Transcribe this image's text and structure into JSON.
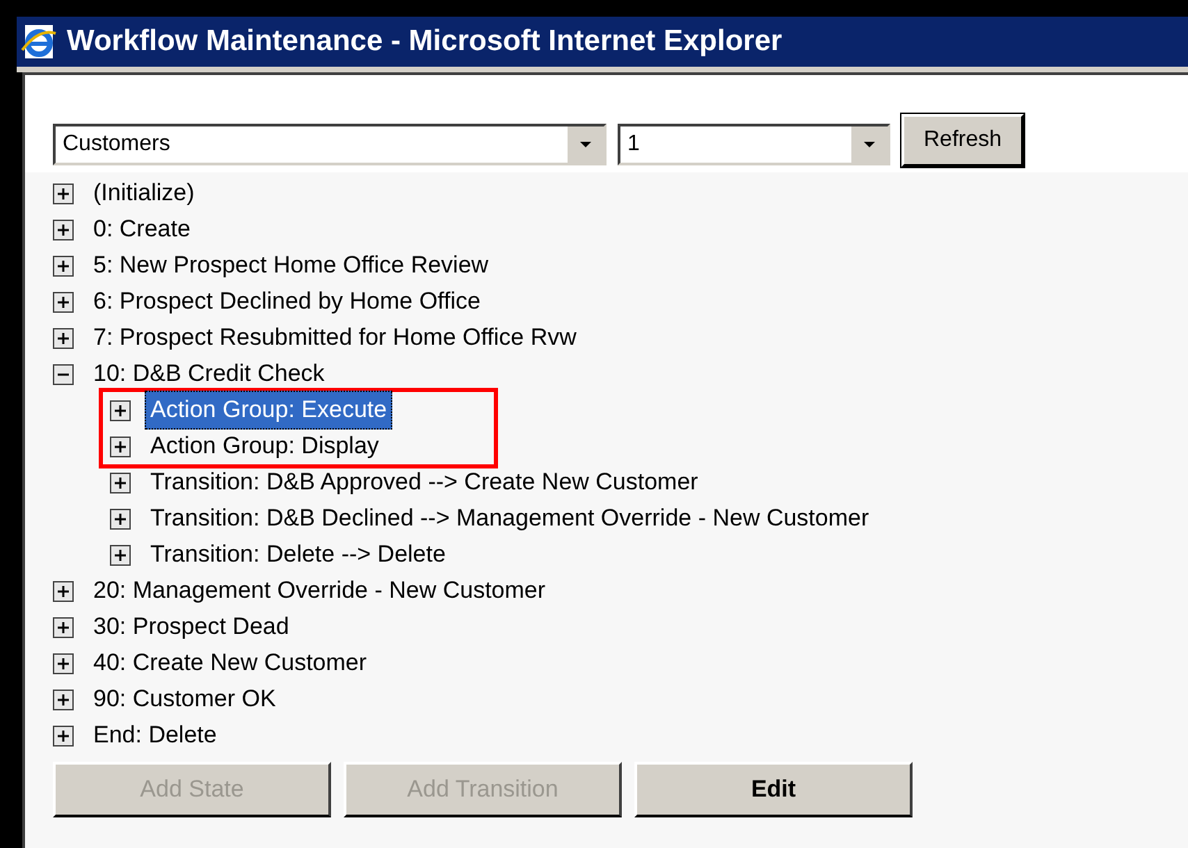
{
  "window": {
    "title": "Workflow Maintenance - Microsoft Internet Explorer"
  },
  "toolbar": {
    "workflow_select": {
      "value": "Customers"
    },
    "version_select": {
      "value": "1"
    },
    "refresh_button": "Refresh"
  },
  "tree": [
    {
      "label": "(Initialize)",
      "expanded": false,
      "selected": false
    },
    {
      "label": "0: Create",
      "expanded": false,
      "selected": false
    },
    {
      "label": "5: New Prospect Home Office Review",
      "expanded": false,
      "selected": false
    },
    {
      "label": "6: Prospect Declined by Home Office",
      "expanded": false,
      "selected": false
    },
    {
      "label": "7: Prospect Resubmitted for Home Office Rvw",
      "expanded": false,
      "selected": false
    },
    {
      "label": "10: D&B Credit Check",
      "expanded": true,
      "selected": false,
      "children": [
        {
          "label": "Action Group: Execute",
          "expanded": false,
          "selected": true,
          "highlighted": true
        },
        {
          "label": "Action Group: Display",
          "expanded": false,
          "selected": false,
          "highlighted": true
        },
        {
          "label": "Transition: D&B Approved --> Create New Customer",
          "expanded": false,
          "selected": false,
          "highlighted": false
        },
        {
          "label": "Transition: D&B Declined --> Management Override - New Customer",
          "expanded": false,
          "selected": false,
          "highlighted": false
        },
        {
          "label": "Transition: Delete --> Delete",
          "expanded": false,
          "selected": false,
          "highlighted": false
        }
      ]
    },
    {
      "label": "20: Management Override - New Customer",
      "expanded": false,
      "selected": false
    },
    {
      "label": "30: Prospect Dead",
      "expanded": false,
      "selected": false
    },
    {
      "label": "40: Create New Customer",
      "expanded": false,
      "selected": false
    },
    {
      "label": "90: Customer OK",
      "expanded": false,
      "selected": false
    },
    {
      "label": "End: Delete",
      "expanded": false,
      "selected": false
    }
  ],
  "buttons": [
    {
      "label": "Add State",
      "disabled": true
    },
    {
      "label": "Add Transition",
      "disabled": true
    },
    {
      "label": "Edit",
      "disabled": false
    }
  ]
}
